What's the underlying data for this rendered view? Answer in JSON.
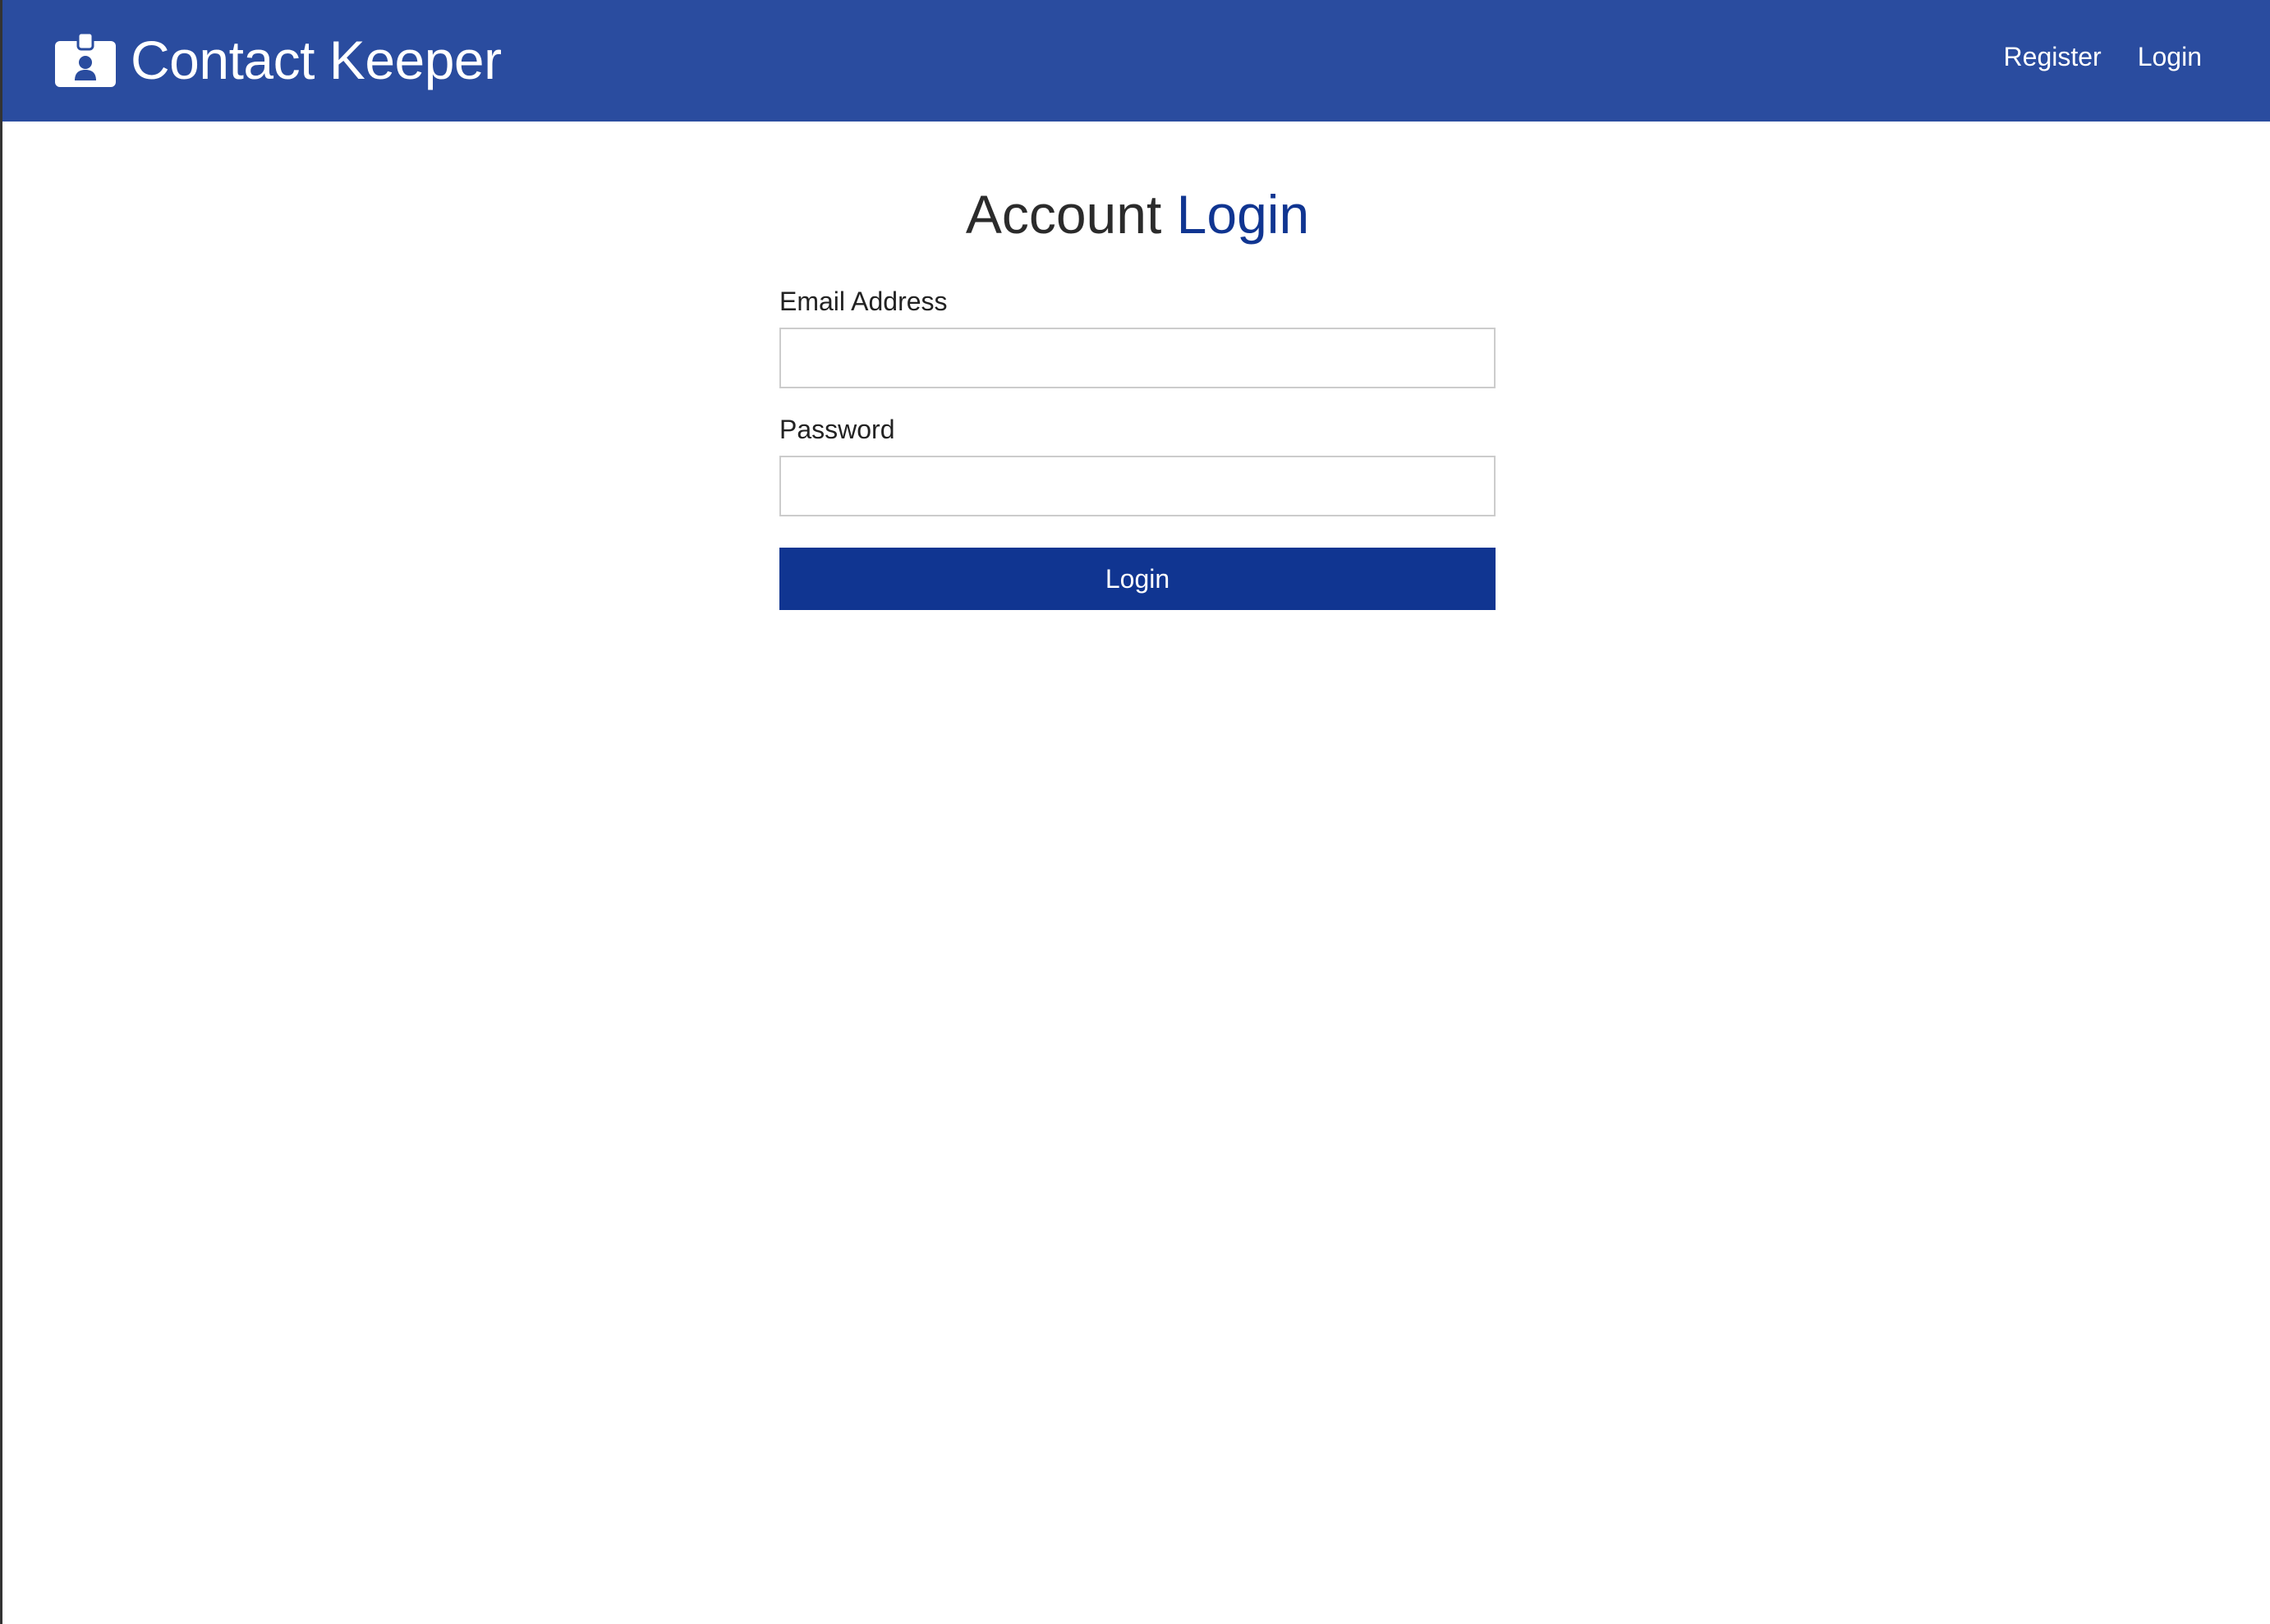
{
  "brand": {
    "title": "Contact Keeper",
    "icon": "id-badge-icon"
  },
  "nav": {
    "links": [
      {
        "label": "Register"
      },
      {
        "label": "Login"
      }
    ]
  },
  "page": {
    "heading_prefix": "Account",
    "heading_accent": "Login"
  },
  "form": {
    "email_label": "Email Address",
    "email_value": "",
    "password_label": "Password",
    "password_value": "",
    "submit_label": "Login"
  },
  "colors": {
    "navbar": "#2a4c9f",
    "primary": "#103591",
    "text": "#2b2b2b"
  }
}
